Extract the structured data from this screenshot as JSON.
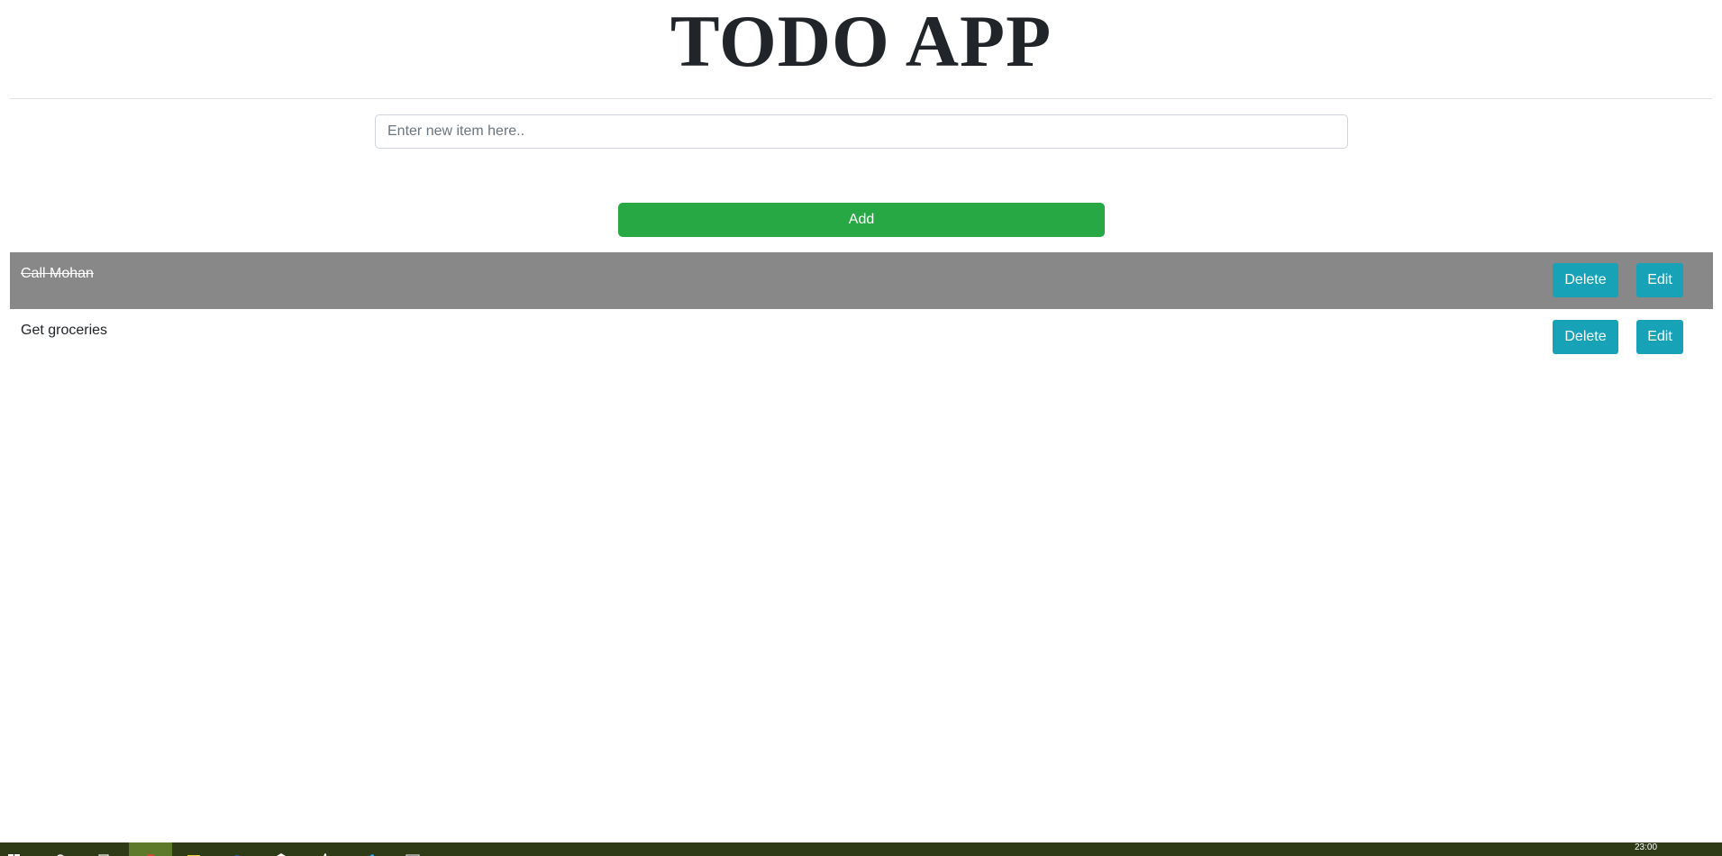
{
  "header": {
    "title": "TODO APP"
  },
  "new_item": {
    "placeholder": "Enter new item here..",
    "value": "",
    "add_label": "Add"
  },
  "todos": [
    {
      "text": "Call Mohan",
      "completed": true,
      "delete_label": "Delete",
      "edit_label": "Edit"
    },
    {
      "text": "Get groceries",
      "completed": false,
      "delete_label": "Delete",
      "edit_label": "Edit"
    }
  ],
  "colors": {
    "add_button": "#28a745",
    "action_buttons": "#17a2b8",
    "completed_row": "#888888",
    "taskbar": "#2f3a17"
  },
  "taskbar": {
    "icons": [
      "windows-start-icon",
      "search-icon",
      "task-view-icon",
      "chrome-icon",
      "file-explorer-icon",
      "edge-icon",
      "dropbox-icon",
      "app-icon",
      "vscode-icon",
      "terminal-icon"
    ],
    "clock_time": "23:00"
  }
}
